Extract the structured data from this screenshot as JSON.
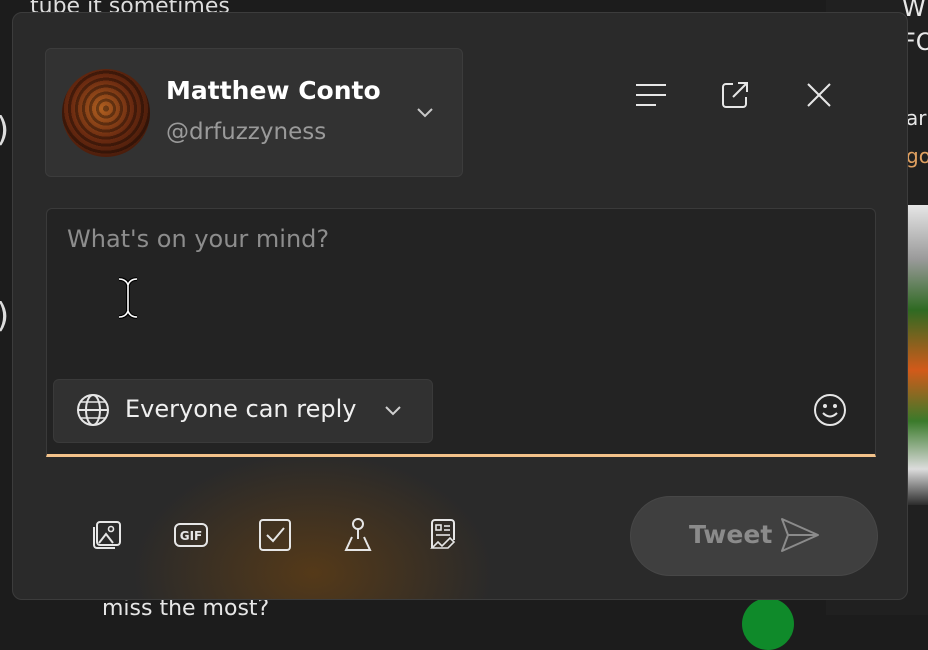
{
  "background": {
    "top_left_text": "tube it sometimes",
    "right_text_1": "W",
    "right_text_2": "FO",
    "right_text_3": "ar",
    "right_text_4": "go",
    "bottom_text": "miss the most?",
    "left_paren_1": ")",
    "left_paren_2": ")"
  },
  "account": {
    "name": "Matthew Conto",
    "handle": "@drfuzzyness"
  },
  "compose": {
    "placeholder": "What's on your mind?",
    "reply_setting": "Everyone can reply",
    "accent_color": "#f3c28a"
  },
  "toolbar_icons": [
    "image-icon",
    "gif-icon",
    "poll-icon",
    "location-icon",
    "schedule-icon"
  ],
  "header_icons": [
    "menu-icon",
    "open-external-icon",
    "close-icon"
  ],
  "tweet_button": {
    "label": "Tweet",
    "state": "disabled"
  }
}
